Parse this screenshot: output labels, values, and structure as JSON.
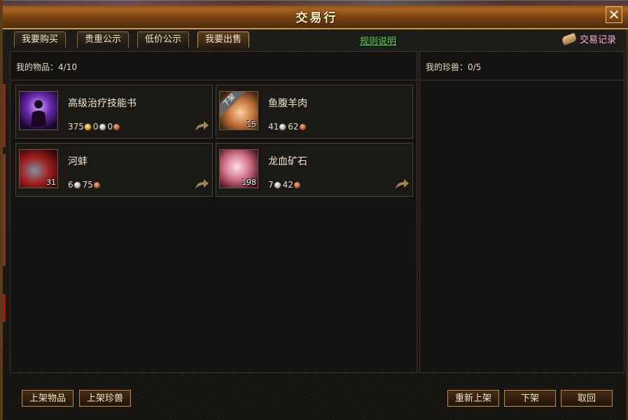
{
  "window": {
    "title": "交易行",
    "close": "✕"
  },
  "tabs": [
    {
      "label": "我要购买"
    },
    {
      "label": "贵重公示"
    },
    {
      "label": "低价公示"
    },
    {
      "label": "我要出售"
    }
  ],
  "links": {
    "rules": "规则说明",
    "records": "交易记录"
  },
  "items_panel": {
    "header": "我的物品：4/10",
    "items": [
      {
        "name": "高级治疗技能书",
        "icon": "skill-book-icon",
        "price": {
          "gold": "375",
          "silver": "0",
          "copper": "0"
        }
      },
      {
        "name": "鱼腹羊肉",
        "icon": "meat-icon",
        "qty": "15",
        "tag": "下架",
        "price": {
          "silver": "41",
          "copper": "62"
        }
      },
      {
        "name": "河蚌",
        "icon": "clam-icon",
        "qty": "31",
        "price": {
          "silver": "6",
          "copper": "75"
        }
      },
      {
        "name": "龙血矿石",
        "icon": "ore-icon",
        "qty": "198",
        "price": {
          "silver": "7",
          "copper": "42"
        }
      }
    ]
  },
  "pets_panel": {
    "header": "我的珍兽：0/5"
  },
  "buttons": {
    "list_item": "上架物品",
    "list_pet": "上架珍兽",
    "relist": "重新上架",
    "delist": "下架",
    "cancel": "取回"
  }
}
